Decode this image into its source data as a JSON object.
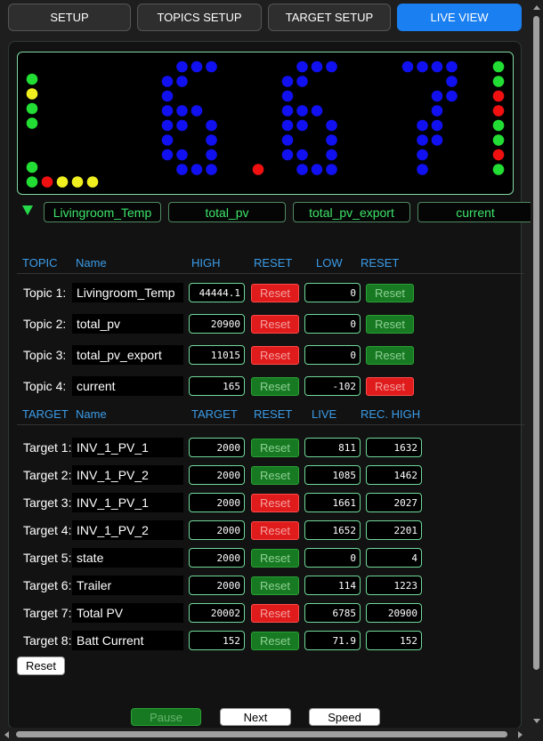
{
  "tabs": [
    "SETUP",
    "TOPICS SETUP",
    "TARGET SETUP",
    "LIVE VIEW"
  ],
  "active_tab": "LIVE VIEW",
  "display": {
    "digits": "667",
    "decimal_after_index": 1,
    "colors": {
      "digit": "#1010f0",
      "green": "#22dd33",
      "yellow": "#f0f020",
      "red": "#f01010"
    }
  },
  "topic_selector": [
    "Livingroom_Temp",
    "total_pv",
    "total_pv_export",
    "current"
  ],
  "topics_header": {
    "c1": "TOPIC",
    "c2": "Name",
    "c3": "HIGH",
    "c4": "RESET",
    "c5": "LOW",
    "c6": "RESET"
  },
  "topics": [
    {
      "label": "Topic 1:",
      "name": "Livingroom_Temp",
      "high": "44444.1",
      "high_reset": "Reset",
      "high_state": "red",
      "low": "0",
      "low_reset": "Reset",
      "low_state": "green"
    },
    {
      "label": "Topic 2:",
      "name": "total_pv",
      "high": "20900",
      "high_reset": "Reset",
      "high_state": "red",
      "low": "0",
      "low_reset": "Reset",
      "low_state": "green"
    },
    {
      "label": "Topic 3:",
      "name": "total_pv_export",
      "high": "11015",
      "high_reset": "Reset",
      "high_state": "red",
      "low": "0",
      "low_reset": "Reset",
      "low_state": "green"
    },
    {
      "label": "Topic 4:",
      "name": "current",
      "high": "165",
      "high_reset": "Reset",
      "high_state": "green",
      "low": "-102",
      "low_reset": "Reset",
      "low_state": "red"
    }
  ],
  "targets_header": {
    "c1": "TARGET",
    "c2": "Name",
    "c3": "TARGET",
    "c4": "RESET",
    "c5": "LIVE",
    "c6": "REC. HIGH"
  },
  "targets": [
    {
      "label": "Target 1:",
      "name": "INV_1_PV_1",
      "target": "2000",
      "reset": "Reset",
      "state": "green",
      "live": "811",
      "rec_high": "1632"
    },
    {
      "label": "Target 2:",
      "name": "INV_1_PV_2",
      "target": "2000",
      "reset": "Reset",
      "state": "green",
      "live": "1085",
      "rec_high": "1462"
    },
    {
      "label": "Target 3:",
      "name": "INV_1_PV_1",
      "target": "2000",
      "reset": "Reset",
      "state": "red",
      "live": "1661",
      "rec_high": "2027"
    },
    {
      "label": "Target 4:",
      "name": "INV_1_PV_2",
      "target": "2000",
      "reset": "Reset",
      "state": "red",
      "live": "1652",
      "rec_high": "2201"
    },
    {
      "label": "Target 5:",
      "name": "state",
      "target": "2000",
      "reset": "Reset",
      "state": "green",
      "live": "0",
      "rec_high": "4"
    },
    {
      "label": "Target 6:",
      "name": "Trailer",
      "target": "2000",
      "reset": "Reset",
      "state": "green",
      "live": "114",
      "rec_high": "1223"
    },
    {
      "label": "Target 7:",
      "name": "Total PV",
      "target": "20002",
      "reset": "Reset",
      "state": "red",
      "live": "6785",
      "rec_high": "20900"
    },
    {
      "label": "Target 8:",
      "name": "Batt Current",
      "target": "152",
      "reset": "Reset",
      "state": "green",
      "live": "71.9",
      "rec_high": "152"
    }
  ],
  "reset_all": "Reset",
  "footer": {
    "pause": "Pause",
    "next": "Next",
    "speed": "Speed"
  }
}
